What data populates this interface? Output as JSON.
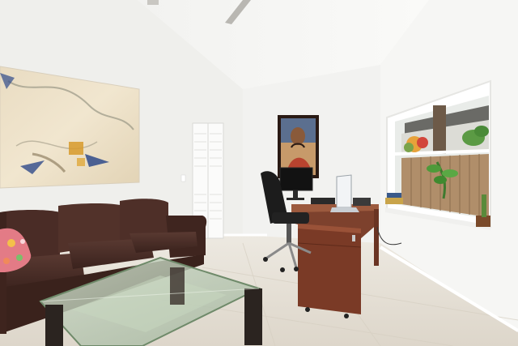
{
  "scene": {
    "palette": {
      "wall": "#f4f4f2",
      "ceiling": "#f7f7f5",
      "floor": "#e8e2d8",
      "sofa": "#4a2e28",
      "desk": "#7a3f2c",
      "glass": "#b9c7b4"
    },
    "objects": [
      "abstract-wall-painting",
      "ceiling-fan",
      "louvered-closet-door",
      "framed-portrait-painting",
      "leather-sofa",
      "pink-floral-pillow",
      "glass-coffee-table",
      "office-chair",
      "computer-monitor",
      "laptop",
      "wooden-desk",
      "filing-cabinet",
      "window-with-plants"
    ]
  }
}
